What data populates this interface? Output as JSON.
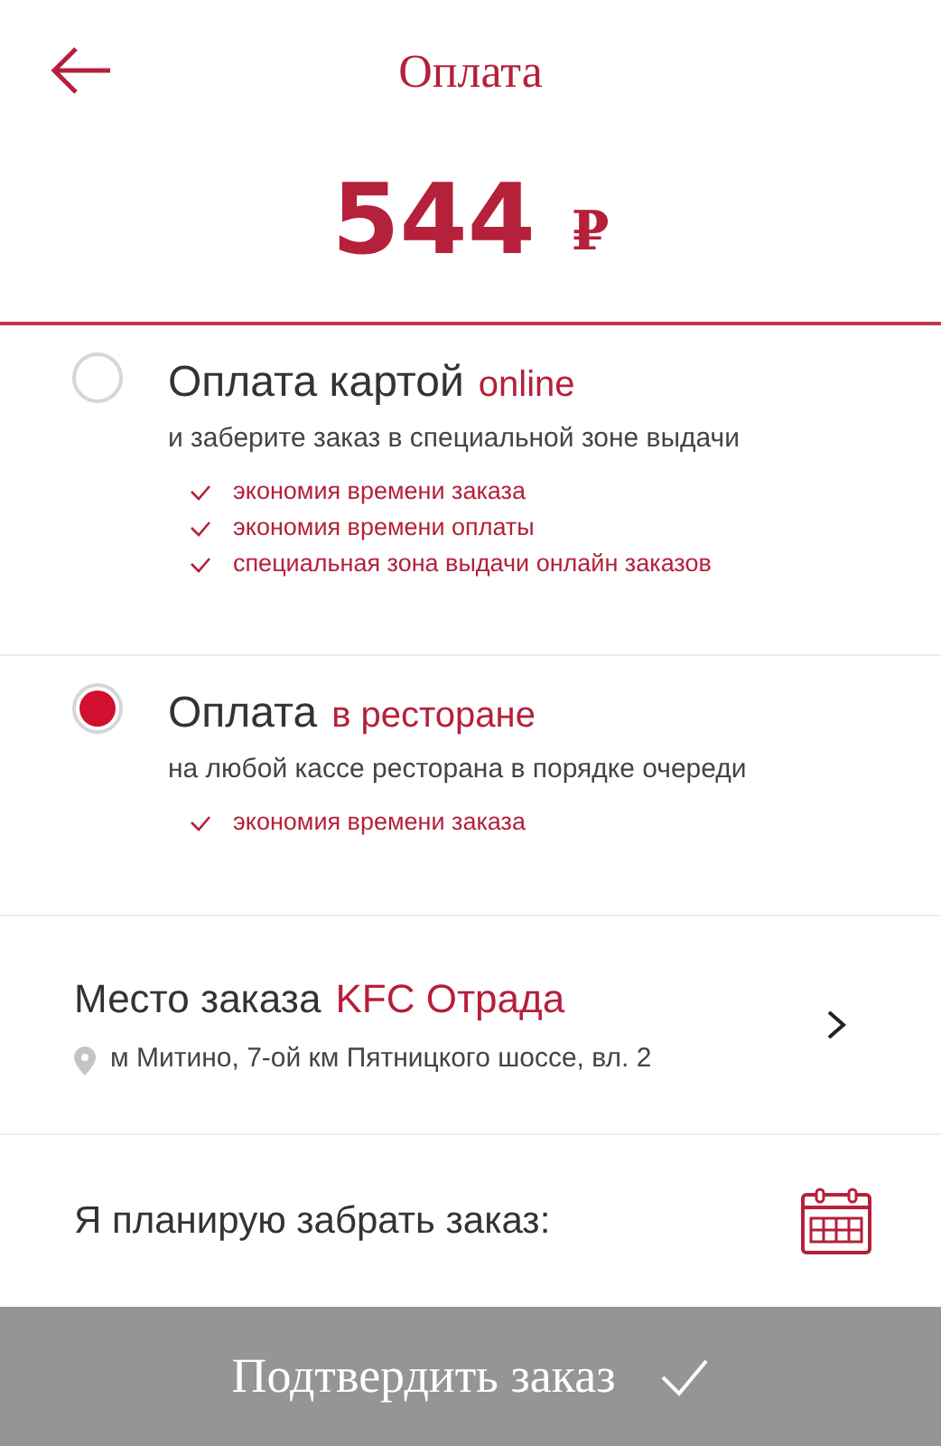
{
  "header": {
    "title": "Оплата",
    "price": "544",
    "currency": "₽"
  },
  "payment_options": [
    {
      "title": "Оплата картой",
      "title_accent": "online",
      "subtitle": "и заберите заказ в специальной зоне выдачи",
      "selected": false,
      "benefits": [
        "экономия времени заказа",
        "экономия времени оплаты",
        "специальная зона выдачи онлайн заказов"
      ]
    },
    {
      "title": "Оплата",
      "title_accent": "в ресторане",
      "subtitle": "на любой кассе ресторана в порядке очереди",
      "selected": true,
      "benefits": [
        "экономия времени заказа"
      ]
    }
  ],
  "place": {
    "label": "Место заказа",
    "name": "KFC Отрада",
    "address": "м Митино, 7-ой км Пятницкого шоссе, вл. 2"
  },
  "pickup": {
    "label": "Я планирую забрать заказ:"
  },
  "confirm_button": {
    "label": "Подтвердить заказ"
  }
}
